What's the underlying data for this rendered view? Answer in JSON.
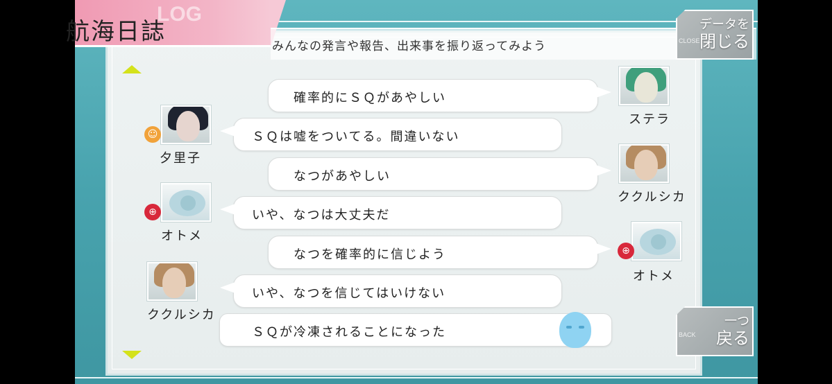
{
  "header": {
    "title": "航海日誌",
    "watermark": "LOG",
    "subtitle": "みんなの発言や報告、出来事を振り返ってみよう"
  },
  "buttons": {
    "close_line1": "データを",
    "close_line2": "閉じる",
    "close_tag": "CLOSE",
    "back_line1": "一つ",
    "back_line2": "戻る",
    "back_tag": "BACK"
  },
  "log": [
    {
      "speaker": "ステラ",
      "side": "right",
      "text": "確率的にＳＱがあやしい"
    },
    {
      "speaker": "夕里子",
      "side": "left",
      "text": "ＳＱは嘘をついてる。間違いない"
    },
    {
      "speaker": "ククルシカ",
      "side": "right",
      "text": "なつがあやしい"
    },
    {
      "speaker": "オトメ",
      "side": "left",
      "text": "いや、なつは大丈夫だ"
    },
    {
      "speaker": "オトメ",
      "side": "right",
      "text": "なつを確率的に信じよう"
    },
    {
      "speaker": "ククルシカ",
      "side": "left",
      "text": "いや、なつを信じてはいけない"
    },
    {
      "speaker": "",
      "side": "system",
      "text": "ＳＱが冷凍されることになった"
    }
  ],
  "colors": {
    "background": "#4fa9b4",
    "title_tab": "#f09ab3",
    "scroll_arrow": "#d4e21b"
  }
}
